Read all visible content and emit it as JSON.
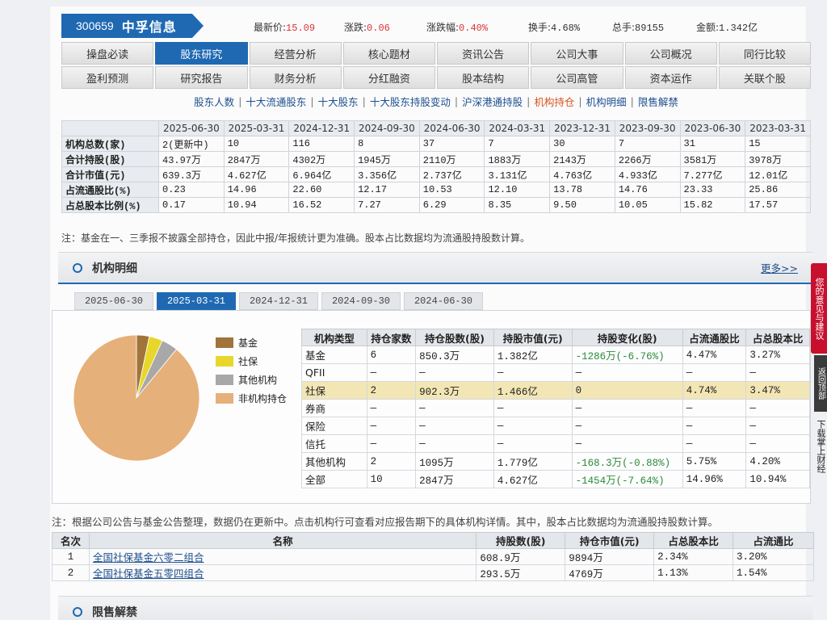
{
  "stock": {
    "code": "300659",
    "name": "中孚信息"
  },
  "quote": {
    "price_label": "最新价:",
    "price": "15.09",
    "change_label": "涨跌:",
    "change": "0.06",
    "pct_label": "涨跌幅:",
    "pct": "0.40%",
    "turnover_label": "换手:",
    "turnover": "4.68%",
    "volume_label": "总手:",
    "volume": "89155",
    "amount_label": "金额:",
    "amount": "1.342亿"
  },
  "nav": {
    "row1": [
      "操盘必读",
      "股东研究",
      "经营分析",
      "核心题材",
      "资讯公告",
      "公司大事",
      "公司概况",
      "同行比较"
    ],
    "row2": [
      "盈利预测",
      "研究报告",
      "财务分析",
      "分红融资",
      "股本结构",
      "公司高管",
      "资本运作",
      "关联个股"
    ],
    "active": "股东研究"
  },
  "subnav": [
    "股东人数",
    "十大流通股东",
    "十大股东",
    "十大股东持股变动",
    "沪深港通持股",
    "机构持仓",
    "机构明细",
    "限售解禁"
  ],
  "subnav_active": "机构持仓",
  "summary": {
    "dates": [
      "2025-06-30",
      "2025-03-31",
      "2024-12-31",
      "2024-09-30",
      "2024-06-30",
      "2024-03-31",
      "2023-12-31",
      "2023-09-30",
      "2023-06-30",
      "2023-03-31"
    ],
    "rows": [
      {
        "label": "机构总数(家)",
        "values": [
          "2(更新中)",
          "10",
          "116",
          "8",
          "37",
          "7",
          "30",
          "7",
          "31",
          "15"
        ]
      },
      {
        "label": "合计持股(股)",
        "values": [
          "43.97万",
          "2847万",
          "4302万",
          "1945万",
          "2110万",
          "1883万",
          "2143万",
          "2266万",
          "3581万",
          "3978万"
        ]
      },
      {
        "label": "合计市值(元)",
        "values": [
          "639.3万",
          "4.627亿",
          "6.964亿",
          "3.356亿",
          "2.737亿",
          "3.131亿",
          "4.763亿",
          "4.933亿",
          "7.277亿",
          "12.01亿"
        ]
      },
      {
        "label": "占流通股比(%)",
        "values": [
          "0.23",
          "14.96",
          "22.60",
          "12.17",
          "10.53",
          "12.10",
          "13.78",
          "14.76",
          "23.33",
          "25.86"
        ]
      },
      {
        "label": "占总股本比例(%)",
        "values": [
          "0.17",
          "10.94",
          "16.52",
          "7.27",
          "6.29",
          "8.35",
          "9.50",
          "10.05",
          "15.82",
          "17.57"
        ]
      }
    ]
  },
  "note1": "注：基金在一、三季报不披露全部持仓，因此中报/年报统计更为准确。股本占比数据均为流通股持股数计算。",
  "section1": {
    "title": "机构明细",
    "more": "更多>>"
  },
  "date_tabs": [
    "2025-06-30",
    "2025-03-31",
    "2024-12-31",
    "2024-09-30",
    "2024-06-30"
  ],
  "date_tab_active": "2025-03-31",
  "legend": [
    {
      "label": "基金",
      "color": "#a0743a"
    },
    {
      "label": "社保",
      "color": "#e8d72a"
    },
    {
      "label": "其他机构",
      "color": "#a8a8a8"
    },
    {
      "label": "非机构持仓",
      "color": "#e6b07a"
    }
  ],
  "pie_shares_pct": {
    "基金": 3.27,
    "社保": 3.47,
    "其他机构": 4.2,
    "非机构持仓": 89.06
  },
  "detail": {
    "headers": [
      "机构类型",
      "持仓家数",
      "持仓股数(股)",
      "持股市值(元)",
      "持股变化(股)",
      "占流通股比",
      "占总股本比"
    ],
    "rows": [
      [
        "基金",
        "6",
        "850.3万",
        "1.382亿",
        "-1286万(-6.76%)",
        "4.47%",
        "3.27%"
      ],
      [
        "QFII",
        "—",
        "—",
        "—",
        "—",
        "—",
        "—"
      ],
      [
        "社保",
        "2",
        "902.3万",
        "1.466亿",
        "0",
        "4.74%",
        "3.47%"
      ],
      [
        "券商",
        "—",
        "—",
        "—",
        "—",
        "—",
        "—"
      ],
      [
        "保险",
        "—",
        "—",
        "—",
        "—",
        "—",
        "—"
      ],
      [
        "信托",
        "—",
        "—",
        "—",
        "—",
        "—",
        "—"
      ],
      [
        "其他机构",
        "2",
        "1095万",
        "1.779亿",
        "-168.3万(-0.88%)",
        "5.75%",
        "4.20%"
      ],
      [
        "全部",
        "10",
        "2847万",
        "4.627亿",
        "-1454万(-7.64%)",
        "14.96%",
        "10.94%"
      ]
    ],
    "highlight_row": 2
  },
  "note2": "注：根据公司公告与基金公告整理，数据仍在更新中。点击机构行可查看对应报告期下的具体机构详情。其中，股本占比数据均为流通股持股数计算。",
  "rank": {
    "headers": [
      "名次",
      "名称",
      "持股数(股)",
      "持仓市值(元)",
      "占总股本比",
      "占流通比"
    ],
    "rows": [
      [
        "1",
        "全国社保基金六零二组合",
        "608.9万",
        "9894万",
        "2.34%",
        "3.20%"
      ],
      [
        "2",
        "全国社保基金五零四组合",
        "293.5万",
        "4769万",
        "1.13%",
        "1.54%"
      ]
    ]
  },
  "section2": {
    "title": "限售解禁"
  },
  "side": {
    "feedback": "您的意见与建议",
    "back": "返回顶部",
    "extra": "下载掌上财经"
  }
}
